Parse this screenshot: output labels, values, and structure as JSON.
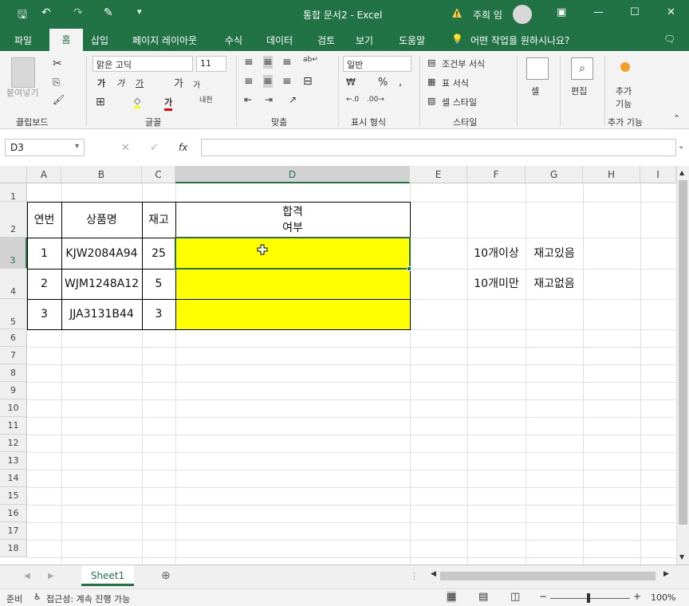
{
  "titlebar": {
    "title": "통합 문서2  -  Excel",
    "user": "주희 임"
  },
  "tabs": [
    "파일",
    "홈",
    "삽입",
    "페이지 레이아웃",
    "수식",
    "데이터",
    "검토",
    "보기",
    "도움말"
  ],
  "tellme": "어떤 작업을 원하시나요?",
  "ribbon": {
    "clipboard": {
      "paste": "붙여넣기",
      "label": "클립보드"
    },
    "font": {
      "name": "맑은 고딕",
      "size": "11",
      "label": "글꼴"
    },
    "align": {
      "label": "맞춤"
    },
    "number": {
      "format": "일반",
      "label": "표시 형식"
    },
    "styles": {
      "cond": "조건부 서식",
      "table": "표 서식",
      "cell": "셀 스타일",
      "label": "스타일"
    },
    "cells": {
      "btn": "셀",
      "label": ""
    },
    "edit": {
      "btn": "편집",
      "label": ""
    },
    "addins": {
      "btn1": "추가",
      "btn2": "기능",
      "label": "추가 기능"
    }
  },
  "formula_bar": {
    "namebox": "D3",
    "fx": "fx",
    "value": ""
  },
  "columns": [
    "A",
    "B",
    "C",
    "D",
    "E",
    "F",
    "G",
    "H",
    "I"
  ],
  "rows": [
    "1",
    "2",
    "3",
    "4",
    "5",
    "6",
    "7",
    "8",
    "9",
    "10",
    "11",
    "12",
    "13",
    "14",
    "15",
    "16",
    "17",
    "18"
  ],
  "table": {
    "headers": {
      "a": "연번",
      "b": "상품명",
      "c": "재고",
      "d1": "합격",
      "d2": "여부"
    },
    "rows": [
      {
        "a": "1",
        "b": "KJW2084A94",
        "c": "25"
      },
      {
        "a": "2",
        "b": "WJM1248A12",
        "c": "5"
      },
      {
        "a": "3",
        "b": "JJA3131B44",
        "c": "3"
      }
    ]
  },
  "criteria": [
    {
      "f": "10개이상",
      "g": "재고있음"
    },
    {
      "f": "10개미만",
      "g": "재고없음"
    }
  ],
  "sheet": {
    "name": "Sheet1"
  },
  "status": {
    "ready": "준비",
    "accessibility": "접근성: 계속 진행 가능",
    "zoom": "100%"
  },
  "colors": {
    "excel_green": "#217346",
    "highlight": "#ffff00"
  }
}
